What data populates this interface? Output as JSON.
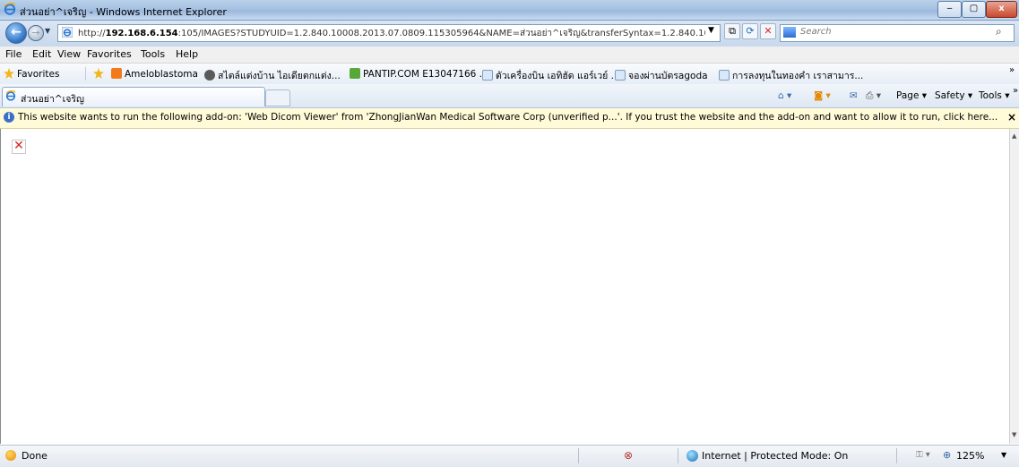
{
  "window": {
    "title": "ส่วนอย่า^เจริญ - Windows Internet Explorer",
    "minimize": "‒",
    "maximize": "▢",
    "close": "x"
  },
  "address": {
    "url_prefix": "http://",
    "url_host": "192.168.6.154",
    "url_rest": ":105/IMAGES?STUDYUID=1.2.840.10008.2013.07.0809.115305964&NAME=ส่วนอย่า^เจริญ&transferSyntax=1.2.840.10008.1.",
    "search_placeholder": "Search"
  },
  "menu": {
    "items": [
      "File",
      "Edit",
      "View",
      "Favorites",
      "Tools",
      "Help"
    ]
  },
  "favorites": {
    "label": "Favorites",
    "links": [
      "Ameloblastoma",
      "สไตล์แต่งบ้าน ไอเดียตกแต่ง...",
      "PANTIP.COM  E13047166 ....",
      "ตัวเครื่องบิน เอทิฮัด แอร์เวย์ ...",
      "จองผ่านบัตรagoda",
      "การลงทุนในทองคำ เราสามาร..."
    ],
    "overflow": "»"
  },
  "tabs": {
    "active_label": "ส่วนอย่า^เจริญ",
    "commands": [
      "Page ▾",
      "Safety ▾",
      "Tools ▾"
    ],
    "overflow": "»"
  },
  "infobar": {
    "message": "This website wants to run the following add-on: 'Web Dicom Viewer' from 'ZhongJianWan Medical Software Corp (unverified p...'. If you trust the website and the add-on and want to allow it to run, click here...",
    "close": "×"
  },
  "content": {
    "broken_image_glyph": "✕"
  },
  "status": {
    "text": "Done",
    "zone": "Internet | Protected Mode: On",
    "zoom": "125%"
  }
}
